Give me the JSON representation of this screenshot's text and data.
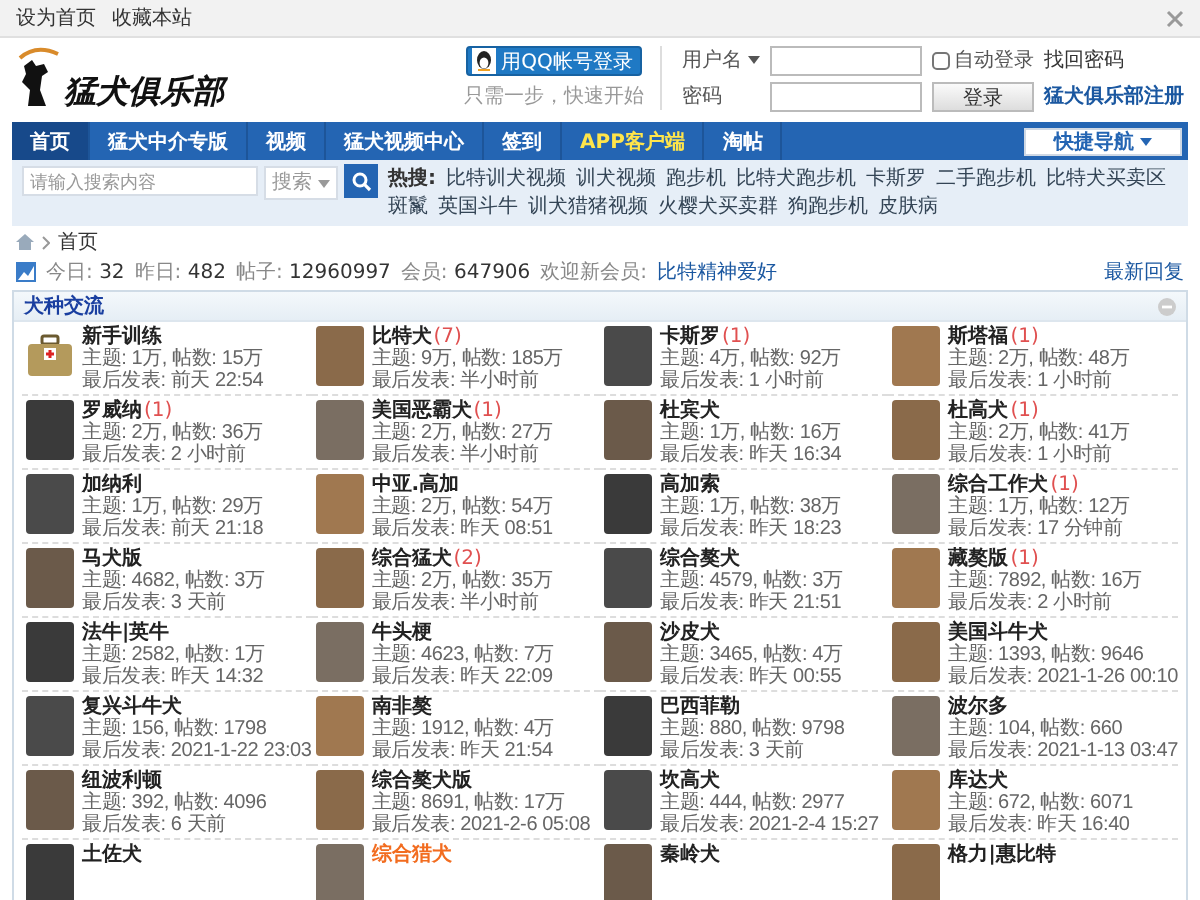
{
  "top_bar": {
    "links": [
      "设为首页",
      "收藏本站"
    ]
  },
  "header": {
    "logo": "猛犬俱乐部",
    "qq_login": {
      "button": "用QQ帐号登录",
      "hint": "只需一步，快速开始"
    },
    "login": {
      "username_label": "用户名",
      "password_label": "密码",
      "auto_login": {
        "label": "自动登录",
        "checked": false
      },
      "find_password": "找回密码",
      "submit": "登录",
      "register": "猛犬俱乐部注册"
    }
  },
  "nav": {
    "items": [
      {
        "label": "首页",
        "selected": true,
        "kind": "normal"
      },
      {
        "label": "猛犬中介专版",
        "selected": false,
        "kind": "normal"
      },
      {
        "label": "视频",
        "selected": false,
        "kind": "normal"
      },
      {
        "label": "猛犬视频中心",
        "selected": false,
        "kind": "normal"
      },
      {
        "label": "签到",
        "selected": false,
        "kind": "normal"
      },
      {
        "label": "APP客户端",
        "selected": false,
        "kind": "highlight"
      },
      {
        "label": "淘帖",
        "selected": false,
        "kind": "normal"
      }
    ],
    "quick_nav": "快捷导航"
  },
  "search": {
    "placeholder": "请输入搜索内容",
    "type": "搜索",
    "hot_label": "热搜:",
    "hot": [
      "比特训犬视频",
      "训犬视频",
      "跑步机",
      "比特犬跑步机",
      "卡斯罗",
      "二手跑步机",
      "比特犬买卖区",
      "斑鬣",
      "英国斗牛",
      "训犬猎猪视频",
      "火樱犬买卖群",
      "狗跑步机",
      "皮肤病"
    ]
  },
  "breadcrumb": [
    "首页"
  ],
  "stats": {
    "items": [
      {
        "label": "今日:",
        "value": "32"
      },
      {
        "label": "昨日:",
        "value": "482"
      },
      {
        "label": "帖子:",
        "value": "12960997"
      },
      {
        "label": "会员:",
        "value": "647906"
      }
    ],
    "welcome_label": "欢迎新会员:",
    "welcome_member": "比特精神爱好",
    "latest_reply": "最新回复"
  },
  "section": {
    "title": "犬种交流",
    "forums": [
      {
        "name": "新手训练",
        "kind": "icon",
        "highlighted": false,
        "topics": "主题: 1万, 帖数: 15万",
        "last_post": "最后发表: 前天 22:54"
      },
      {
        "name": "比特犬",
        "new": "(7)",
        "kind": "photo",
        "highlighted": false,
        "topics": "主题: 9万, 帖数: 185万",
        "last_post": "最后发表: 半小时前"
      },
      {
        "name": "卡斯罗",
        "new": "(1)",
        "kind": "photo",
        "highlighted": false,
        "topics": "主题: 4万, 帖数: 92万",
        "last_post": "最后发表: 1 小时前"
      },
      {
        "name": "斯塔福",
        "new": "(1)",
        "kind": "photo",
        "highlighted": false,
        "topics": "主题: 2万, 帖数: 48万",
        "last_post": "最后发表: 1 小时前"
      },
      {
        "name": "罗威纳",
        "new": "(1)",
        "kind": "photo",
        "highlighted": false,
        "topics": "主题: 2万, 帖数: 36万",
        "last_post": "最后发表: 2 小时前"
      },
      {
        "name": "美国恶霸犬",
        "new": "(1)",
        "kind": "photo",
        "highlighted": false,
        "topics": "主题: 2万, 帖数: 27万",
        "last_post": "最后发表: 半小时前"
      },
      {
        "name": "杜宾犬",
        "kind": "photo",
        "highlighted": false,
        "topics": "主题: 1万, 帖数: 16万",
        "last_post": "最后发表: 昨天 16:34"
      },
      {
        "name": "杜高犬",
        "new": "(1)",
        "kind": "photo",
        "highlighted": false,
        "topics": "主题: 2万, 帖数: 41万",
        "last_post": "最后发表: 1 小时前"
      },
      {
        "name": "加纳利",
        "kind": "photo",
        "highlighted": false,
        "topics": "主题: 1万, 帖数: 29万",
        "last_post": "最后发表: 前天 21:18"
      },
      {
        "name": "中亚.高加",
        "kind": "photo",
        "highlighted": false,
        "topics": "主题: 2万, 帖数: 54万",
        "last_post": "最后发表: 昨天 08:51"
      },
      {
        "name": "高加索",
        "kind": "photo",
        "highlighted": false,
        "topics": "主题: 1万, 帖数: 38万",
        "last_post": "最后发表: 昨天 18:23"
      },
      {
        "name": "综合工作犬",
        "new": "(1)",
        "kind": "photo",
        "highlighted": false,
        "topics": "主题: 1万, 帖数: 12万",
        "last_post": "最后发表: 17 分钟前"
      },
      {
        "name": "马犬版",
        "kind": "photo",
        "highlighted": false,
        "topics": "主题: 4682, 帖数: 3万",
        "last_post": "最后发表: 3 天前"
      },
      {
        "name": "综合猛犬",
        "new": "(2)",
        "kind": "photo",
        "highlighted": false,
        "topics": "主题: 2万, 帖数: 35万",
        "last_post": "最后发表: 半小时前"
      },
      {
        "name": "综合獒犬",
        "kind": "photo",
        "highlighted": false,
        "topics": "主题: 4579, 帖数: 3万",
        "last_post": "最后发表: 昨天 21:51"
      },
      {
        "name": "藏獒版",
        "new": "(1)",
        "kind": "photo",
        "highlighted": false,
        "topics": "主题: 7892, 帖数: 16万",
        "last_post": "最后发表: 2 小时前"
      },
      {
        "name": "法牛|英牛",
        "kind": "photo",
        "highlighted": false,
        "topics": "主题: 2582, 帖数: 1万",
        "last_post": "最后发表: 昨天 14:32"
      },
      {
        "name": "牛头梗",
        "kind": "photo",
        "highlighted": false,
        "topics": "主题: 4623, 帖数: 7万",
        "last_post": "最后发表: 昨天 22:09"
      },
      {
        "name": "沙皮犬",
        "kind": "photo",
        "highlighted": false,
        "topics": "主题: 3465, 帖数: 4万",
        "last_post": "最后发表: 昨天 00:55"
      },
      {
        "name": "美国斗牛犬",
        "kind": "photo",
        "highlighted": false,
        "topics": "主题: 1393, 帖数: 9646",
        "last_post": "最后发表: 2021-1-26 00:10"
      },
      {
        "name": "复兴斗牛犬",
        "kind": "photo",
        "highlighted": false,
        "topics": "主题: 156, 帖数: 1798",
        "last_post": "最后发表: 2021-1-22 23:03"
      },
      {
        "name": "南非獒",
        "kind": "photo",
        "highlighted": false,
        "topics": "主题: 1912, 帖数: 4万",
        "last_post": "最后发表: 昨天 21:54"
      },
      {
        "name": "巴西菲勒",
        "kind": "photo",
        "highlighted": false,
        "topics": "主题: 880, 帖数: 9798",
        "last_post": "最后发表: 3 天前"
      },
      {
        "name": "波尔多",
        "kind": "photo",
        "highlighted": false,
        "topics": "主题: 104, 帖数: 660",
        "last_post": "最后发表: 2021-1-13 03:47"
      },
      {
        "name": "纽波利顿",
        "kind": "photo",
        "highlighted": false,
        "topics": "主题: 392, 帖数: 4096",
        "last_post": "最后发表: 6 天前"
      },
      {
        "name": "综合獒犬版",
        "kind": "photo",
        "highlighted": false,
        "topics": "主题: 8691, 帖数: 17万",
        "last_post": "最后发表: 2021-2-6 05:08"
      },
      {
        "name": "坎高犬",
        "kind": "photo",
        "highlighted": false,
        "topics": "主题: 444, 帖数: 2977",
        "last_post": "最后发表: 2021-2-4 15:27"
      },
      {
        "name": "库达犬",
        "kind": "photo",
        "highlighted": false,
        "topics": "主题: 672, 帖数: 6071",
        "last_post": "最后发表: 昨天 16:40"
      },
      {
        "name": "土佐犬",
        "kind": "photo",
        "highlighted": false
      },
      {
        "name": "综合猎犬",
        "kind": "photo",
        "highlighted": true
      },
      {
        "name": "秦岭犬",
        "kind": "photo",
        "highlighted": false
      },
      {
        "name": "格力|惠比特",
        "kind": "photo",
        "highlighted": false
      }
    ]
  }
}
